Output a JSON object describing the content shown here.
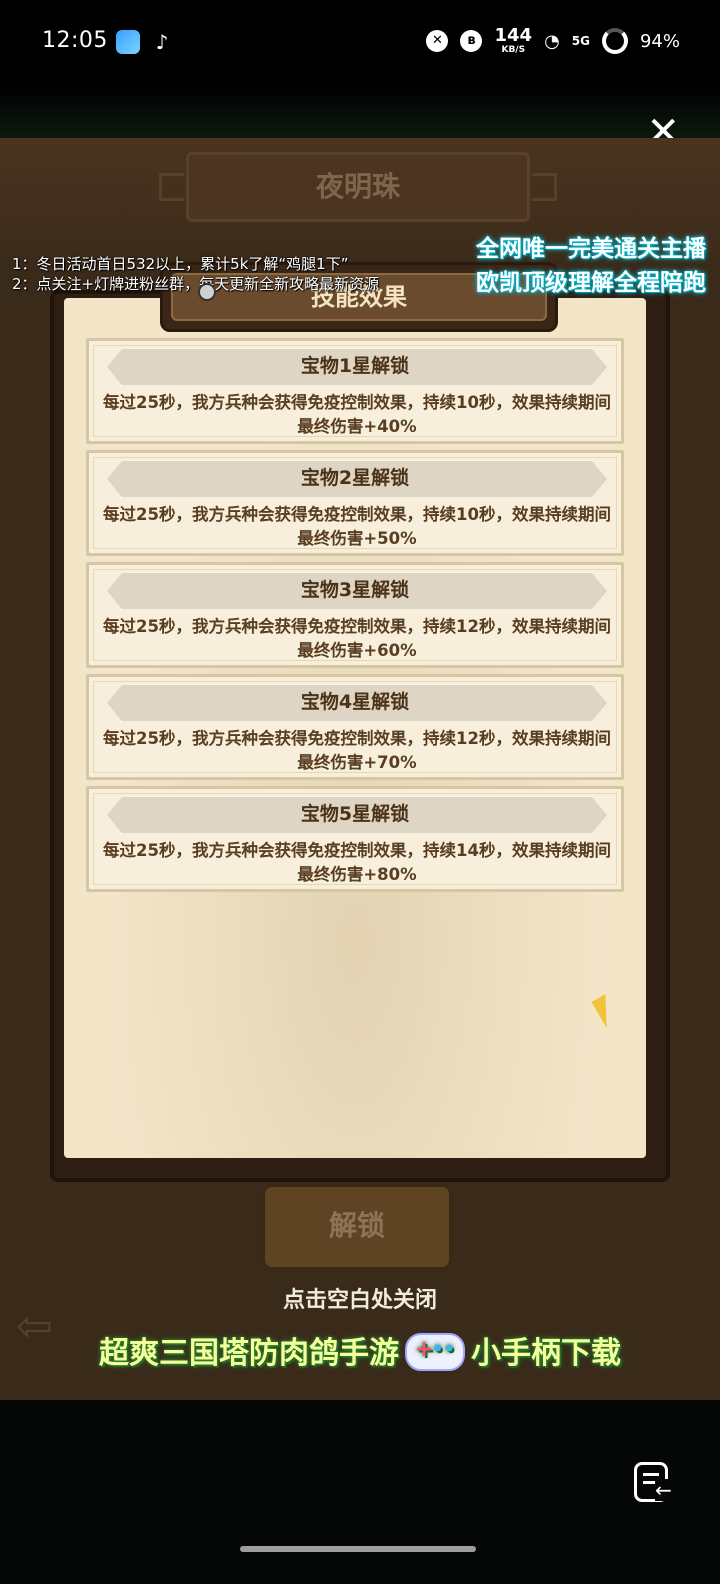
{
  "status_bar": {
    "time": "12:05",
    "speed_value": "144",
    "speed_unit": "KB/S",
    "network": "5G",
    "battery": "94%"
  },
  "game": {
    "top_title": "夜明珠",
    "panel_header": "技能效果",
    "cards": [
      {
        "title": "宝物1星解锁",
        "desc": "每过25秒，我方兵种会获得免疫控制效果，持续10秒，效果持续期间最终伤害+40%"
      },
      {
        "title": "宝物2星解锁",
        "desc": "每过25秒，我方兵种会获得免疫控制效果，持续10秒，效果持续期间最终伤害+50%"
      },
      {
        "title": "宝物3星解锁",
        "desc": "每过25秒，我方兵种会获得免疫控制效果，持续12秒，效果持续期间最终伤害+60%"
      },
      {
        "title": "宝物4星解锁",
        "desc": "每过25秒，我方兵种会获得免疫控制效果，持续12秒，效果持续期间最终伤害+70%"
      },
      {
        "title": "宝物5星解锁",
        "desc": "每过25秒，我方兵种会获得免疫控制效果，持续14秒，效果持续期间最终伤害+80%"
      }
    ],
    "unlock_button": "解锁",
    "close_hint": "点击空白处关闭"
  },
  "overlay": {
    "left_line1": "1：冬日活动首日532以上，累计5k了解“鸡腿1下”",
    "left_line2": "2：点关注+灯牌进粉丝群，每天更新全新攻略最新资源",
    "right_line1": "全网唯一完美通关主播",
    "right_line2": "欧凯顶级理解全程陪跑",
    "promo_left": "超爽三国塔防肉鸽手游",
    "promo_right": "小手柄下载"
  },
  "icons": {
    "close": "close-icon",
    "comment": "comment-icon"
  }
}
